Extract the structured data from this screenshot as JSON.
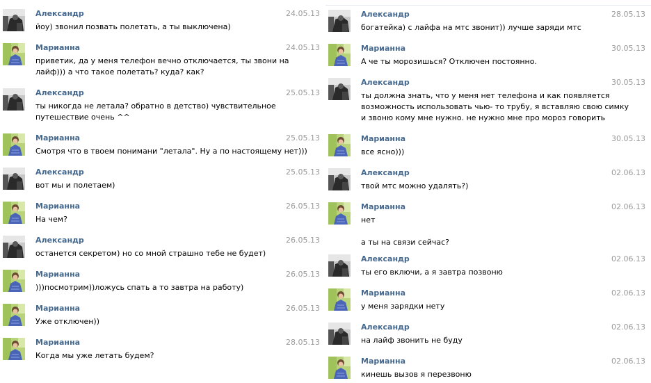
{
  "left_column": [
    {
      "author": "Александр",
      "date": "24.05.13",
      "avatar": "alexandr",
      "lines": [
        "йоу) звонил позвать полетать, а ты выключена)"
      ]
    },
    {
      "author": "Марианна",
      "date": "24.05.13",
      "avatar": "marianna",
      "lines": [
        "приветик, да у меня телефон вечно отключается, ты звони на",
        "лайф))) а что такое полетать? куда? как?"
      ]
    },
    {
      "author": "Александр",
      "date": "25.05.13",
      "avatar": "alexandr",
      "lines": [
        "ты никогда не летала? обратно в детство) чувствительное",
        "путешествие очень ^^"
      ]
    },
    {
      "author": "Марианна",
      "date": "25.05.13",
      "avatar": "marianna",
      "lines": [
        "Смотря что в твоем понимани \"летала\". Ну а по настоящему нет)))"
      ]
    },
    {
      "author": "Александр",
      "date": "25.05.13",
      "avatar": "alexandr",
      "lines": [
        "вот мы и полетаем)"
      ]
    },
    {
      "author": "Марианна",
      "date": "26.05.13",
      "avatar": "marianna",
      "lines": [
        "На чем?"
      ]
    },
    {
      "author": "Александр",
      "date": "26.05.13",
      "avatar": "alexandr",
      "lines": [
        "останется секретом) но со мной страшно тебе не будет)"
      ]
    },
    {
      "author": "Марианна",
      "date": "26.05.13",
      "avatar": "marianna",
      "lines": [
        ")))посмотрим))ложусь спать а то завтра на работу)"
      ]
    },
    {
      "author": "Марианна",
      "date": "26.05.13",
      "avatar": "marianna",
      "lines": [
        "Уже отключен))"
      ]
    },
    {
      "author": "Марианна",
      "date": "28.05.13",
      "avatar": "marianna",
      "lines": [
        "Когда мы уже летать будем?"
      ]
    }
  ],
  "right_column": [
    {
      "author": "Александр",
      "date": "28.05.13",
      "avatar": "alexandr",
      "lines": [
        "богатейка) с лайфа на мтс звонит)) лучше заряди мтс"
      ]
    },
    {
      "author": "Марианна",
      "date": "30.05.13",
      "avatar": "marianna",
      "lines": [
        "А че ты морозишься? Отключен постоянно."
      ]
    },
    {
      "author": "Александр",
      "date": "30.05.13",
      "avatar": "alexandr",
      "lines": [
        "ты должна знать, что у меня нет телефона и как появляется",
        "возможность использовать чью- то трубу, я вставляю свою симку",
        "и звоню кому мне нужно. не нужно мне про мороз говорить"
      ]
    },
    {
      "author": "Марианна",
      "date": "30.05.13",
      "avatar": "marianna",
      "lines": [
        "все ясно)))"
      ]
    },
    {
      "author": "Александр",
      "date": "02.06.13",
      "avatar": "alexandr",
      "lines": [
        "твой мтс можно удалять?)"
      ]
    },
    {
      "author": "Марианна",
      "date": "02.06.13",
      "avatar": "marianna",
      "lines": [
        "нет",
        "",
        "а ты на связи сейчас?"
      ]
    },
    {
      "author": "Александр",
      "date": "02.06.13",
      "avatar": "alexandr",
      "lines": [
        "ты его включи, а я завтра позвоню"
      ]
    },
    {
      "author": "Марианна",
      "date": "02.06.13",
      "avatar": "marianna",
      "lines": [
        "у меня зарядки нету"
      ]
    },
    {
      "author": "Александр",
      "date": "02.06.13",
      "avatar": "alexandr",
      "lines": [
        "на лайф звонить не буду"
      ]
    },
    {
      "author": "Марианна",
      "date": "02.06.13",
      "avatar": "marianna",
      "lines": [
        "кинешь вызов я перезвоню"
      ]
    }
  ],
  "colors": {
    "author": "#45688e",
    "date": "#999999",
    "text": "#000000",
    "divider": "#e4e8ed"
  }
}
